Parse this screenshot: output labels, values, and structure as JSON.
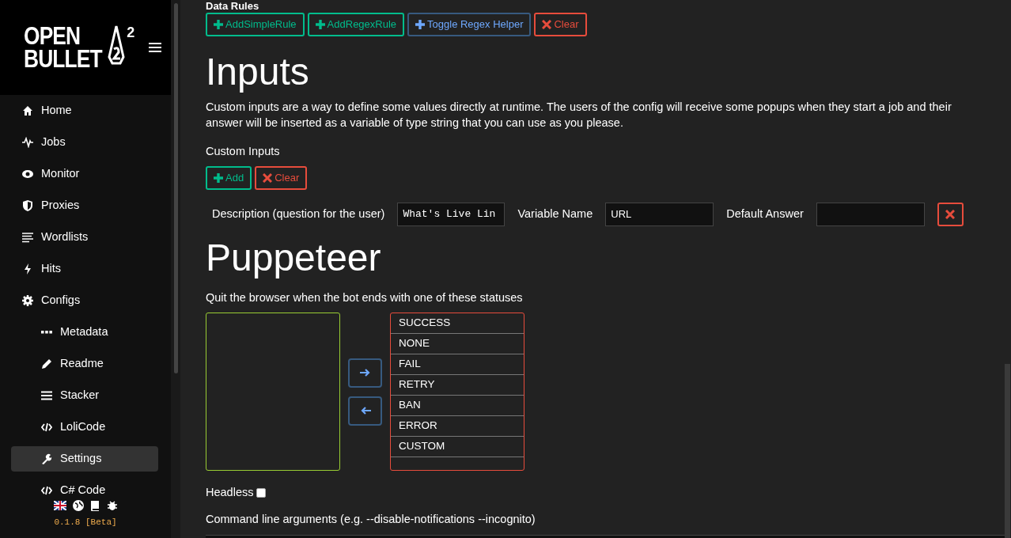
{
  "sidebar": {
    "logo": {
      "line1": "OPEN",
      "line2": "BULLET",
      "superscript": "2"
    },
    "items": [
      {
        "label": "Home",
        "selected": false
      },
      {
        "label": "Jobs",
        "selected": false
      },
      {
        "label": "Monitor",
        "selected": false
      },
      {
        "label": "Proxies",
        "selected": false
      },
      {
        "label": "Wordlists",
        "selected": false
      },
      {
        "label": "Hits",
        "selected": false
      },
      {
        "label": "Configs",
        "selected": false,
        "children": [
          {
            "label": "Metadata",
            "selected": false
          },
          {
            "label": "Readme",
            "selected": false
          },
          {
            "label": "Stacker",
            "selected": false
          },
          {
            "label": "LoliCode",
            "selected": false
          },
          {
            "label": "Settings",
            "selected": true
          },
          {
            "label": "C# Code",
            "selected": false
          }
        ]
      }
    ],
    "version": "0.1.8 [Beta]"
  },
  "data_rules": {
    "heading": "Data Rules",
    "buttons": [
      {
        "label": "AddSimpleRule",
        "kind": "add"
      },
      {
        "label": "AddRegexRule",
        "kind": "add"
      },
      {
        "label": "Toggle Regex Helper",
        "kind": "toggle"
      },
      {
        "label": "Clear",
        "kind": "clear"
      }
    ]
  },
  "inputs": {
    "heading": "Inputs",
    "description": "Custom inputs are a way to define some values directly at runtime. The users of the config will receive some popups when they start a job and their answer will be inserted as a variable of type string that you can use as you please.",
    "custom_inputs_label": "Custom Inputs",
    "buttons": [
      {
        "label": "Add",
        "kind": "add"
      },
      {
        "label": "Clear",
        "kind": "clear"
      }
    ],
    "rows": [
      {
        "description_label": "Description (question for the user)",
        "description_value": "What's Live Lin",
        "variable_label": "Variable Name",
        "variable_value": "URL",
        "default_label": "Default Answer"
      }
    ]
  },
  "puppeteer": {
    "heading": "Puppeteer",
    "quit_label": "Quit the browser when the bot ends with one of these statuses",
    "selected_statuses": [
      "SUCCESS",
      "NONE",
      "FAIL",
      "RETRY",
      "BAN",
      "ERROR",
      "CUSTOM"
    ],
    "headless_label": "Headless",
    "headless": false,
    "command_args_label": "Command line arguments (e.g. --disable-notifications --incognito)"
  }
}
